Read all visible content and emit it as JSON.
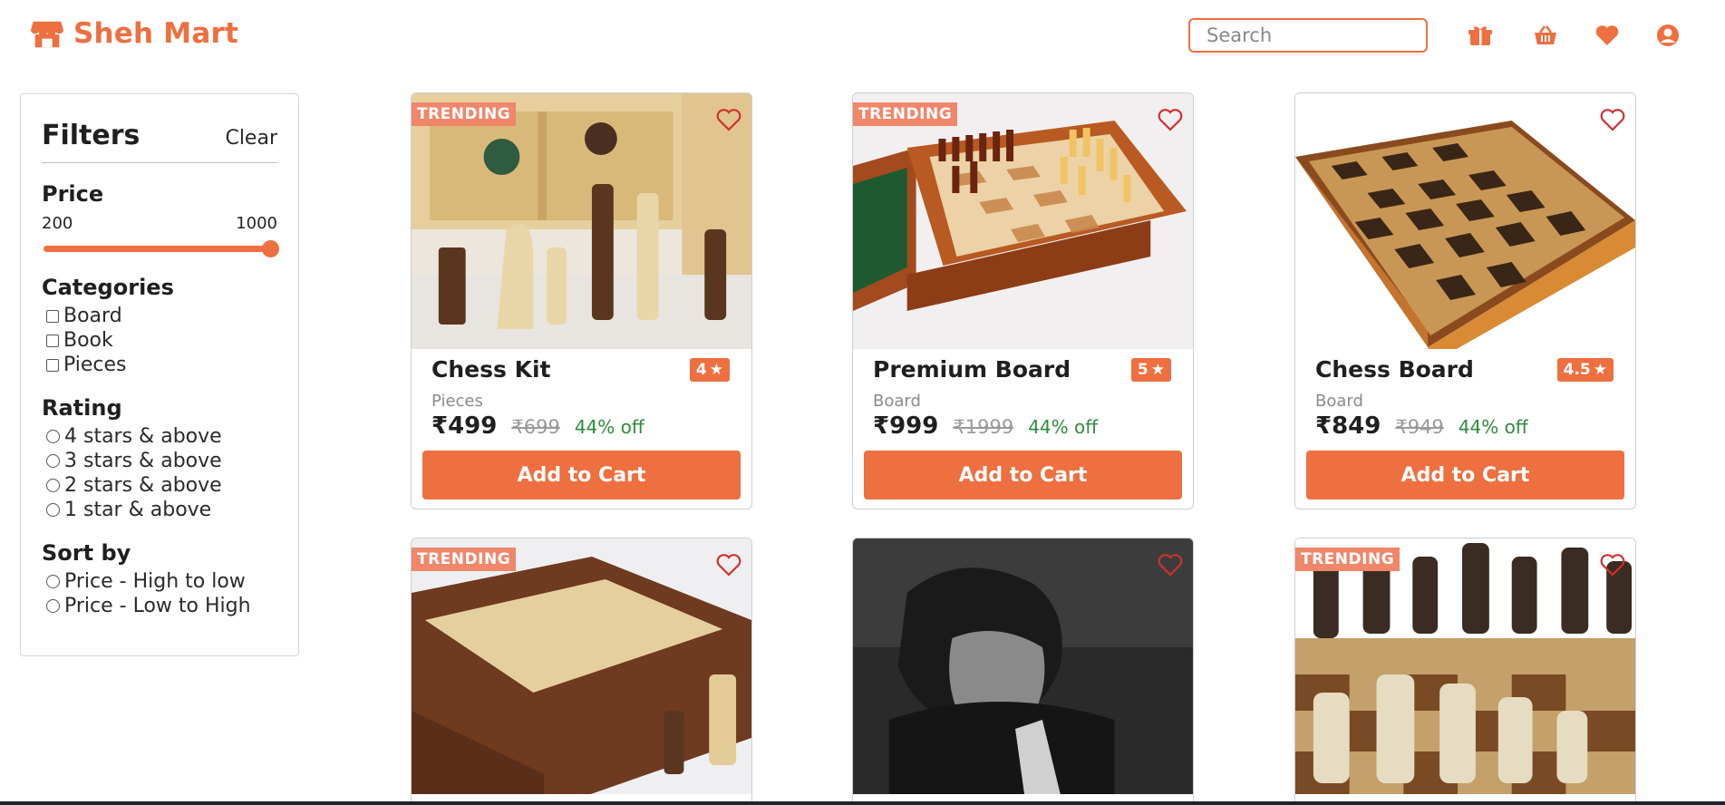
{
  "brand": {
    "name": "Sheh Mart",
    "icon": "store-icon",
    "color": "#ee6f3f"
  },
  "search": {
    "placeholder": "Search",
    "icon": "search-icon"
  },
  "header_icons": [
    "gift-icon",
    "basket-icon",
    "heart-icon",
    "user-icon"
  ],
  "filters": {
    "title": "Filters",
    "clear_label": "Clear",
    "price": {
      "title": "Price",
      "min": "200",
      "max": "1000"
    },
    "categories": {
      "title": "Categories",
      "items": [
        "Board",
        "Book",
        "Pieces"
      ]
    },
    "rating": {
      "title": "Rating",
      "items": [
        "4 stars & above",
        "3 stars & above",
        "2 stars & above",
        "1 star & above"
      ]
    },
    "sort": {
      "title": "Sort by",
      "items": [
        "Price - High to low",
        "Price - Low to High"
      ]
    }
  },
  "products": [
    {
      "badge": "TRENDING",
      "name": "Chess Kit",
      "rating": "4",
      "category": "Pieces",
      "price": "₹499",
      "mrp": "₹699",
      "off": "44% off",
      "button": "Add to Cart"
    },
    {
      "badge": "TRENDING",
      "name": "Premium Board",
      "rating": "5",
      "category": "Board",
      "price": "₹999",
      "mrp": "₹1999",
      "off": "44% off",
      "button": "Add to Cart"
    },
    {
      "badge": "",
      "name": "Chess Board",
      "rating": "4.5",
      "category": "Board",
      "price": "₹849",
      "mrp": "₹949",
      "off": "44% off",
      "button": "Add to Cart"
    },
    {
      "badge": "TRENDING"
    },
    {
      "badge": ""
    },
    {
      "badge": "TRENDING"
    }
  ],
  "colors": {
    "accent": "#ee6f3f",
    "badge": "#f0866a",
    "discount": "#2e8b3c"
  }
}
